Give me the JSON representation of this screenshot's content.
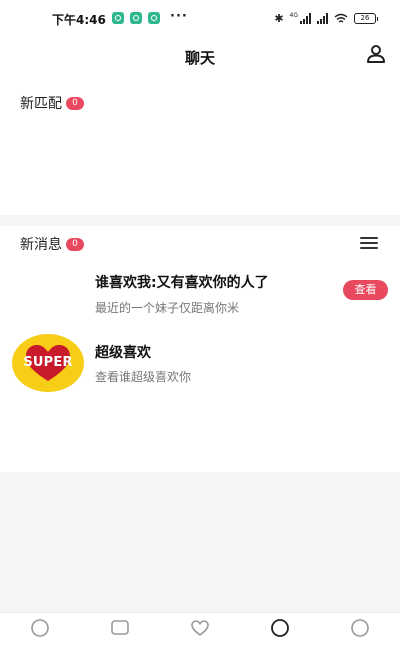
{
  "status_bar": {
    "time": "下午4:46",
    "more": "···",
    "battery": "26",
    "network_label": "4G"
  },
  "header": {
    "title": "聊天"
  },
  "new_matches": {
    "title": "新匹配",
    "count": "0"
  },
  "messages": {
    "title": "新消息",
    "count": "0",
    "items": [
      {
        "title": "谁喜欢我:又有喜欢你的人了",
        "subtitle": "最近的一个妹子仅距离你米",
        "action": "查看"
      },
      {
        "title": "超级喜欢",
        "subtitle": "查看谁超级喜欢你",
        "avatar_text": "SUPER"
      }
    ]
  },
  "tabbar": {
    "icons": [
      "search-icon",
      "chat-bubble-icon",
      "heart-icon",
      "chat-active-icon",
      "profile-icon"
    ]
  },
  "colors": {
    "accent": "#e8495e",
    "super_yellow": "#f7cd18",
    "notif_green": "#2fb88f"
  }
}
